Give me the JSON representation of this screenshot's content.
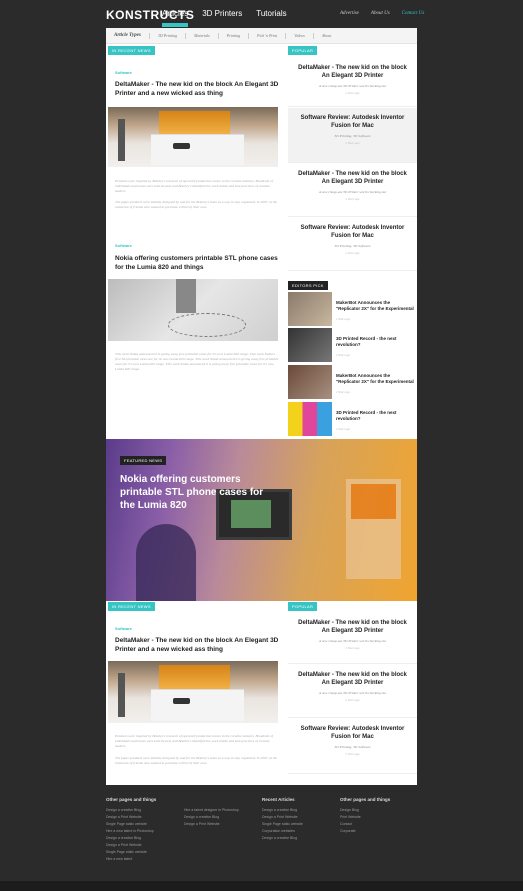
{
  "header": {
    "logo": "KONSTRUCTS",
    "nav": [
      "Articles",
      "3D Printers",
      "Tutorials"
    ],
    "right_nav": [
      "Advertise",
      "About Us",
      "Contact Us"
    ]
  },
  "article_types": {
    "title": "Article Types",
    "items": [
      "3D Printing",
      "Materials",
      "Printing",
      "Pick 'n Print",
      "Videos",
      "About"
    ]
  },
  "section1": {
    "recent_badge": "IN RECENT NEWS",
    "popular_badge": "POPULAR",
    "articles": [
      {
        "category": "Software",
        "title": "DeltaMaker - The new kid on the block An Elegant 3D Printer and a new wicked ass thing",
        "excerpt1": "Products were inspired by Bekeley's research of open/self production routes in the creative industry. Hundreds of individuals and teams were interviewed, and Bekeley's identified the work habits and best practices of creative leaders.",
        "excerpt2": "The paper products were initially designed by and for the Bekeley's team as a way to stay organized. In 2007, at the insistence of friends who wanted to purchase a Pixel of their own."
      },
      {
        "category": "Software",
        "title": "Nokia offering customers printable STL phone cases for the Lumia 820 and things",
        "excerpt1": "This week Nokia announced it is giving away free printable cases for it's new Lumia 820 range. This week Nokia's first 3d-printable cases are for its new Lumia 820 range. This week Nokia announced it is giving away free printable cases for it's new Lumia 820 range. This week Nokia announced it is giving away free printable cases for it's new Lumia 820 range."
      }
    ],
    "popular": [
      {
        "title": "DeltaMaker - The new kid on the block An Elegant 3D Printer",
        "sub": "A new cheap-ass 3D Printer worth checking out",
        "meta": "2 Years ago"
      },
      {
        "title": "Software Review: Autodesk Inventor Fusion for Mac",
        "sub": "3D Printing, 3D Software",
        "meta": "2 Years ago"
      },
      {
        "title": "DeltaMaker - The new kid on the block An Elegant 3D Printer",
        "sub": "A new cheap-ass 3D Printer worth checking out",
        "meta": "2 Years ago"
      },
      {
        "title": "Software Review: Autodesk Inventor Fusion for Mac",
        "sub": "3D Printing, 3D Software",
        "meta": "2 Years ago"
      }
    ],
    "editors_pick_badge": "EDITORS PICK",
    "editors_picks": [
      {
        "title": "MakerBot Announces the \"Replicator 2X\" for the Experimental",
        "meta": "2 Years ago"
      },
      {
        "title": "3D Printed Record - the next revolution?",
        "meta": "2 Years ago"
      },
      {
        "title": "MakerBot Announces the \"Replicator 2X\" for the Experimental",
        "meta": "2 Years ago"
      },
      {
        "title": "3D Printed Record - the next revolution?",
        "meta": "2 Years ago"
      }
    ]
  },
  "featured": {
    "badge": "FEATURED NEWS",
    "title": "Nokia offering customers printable STL phone cases for the Lumia 820"
  },
  "section2": {
    "recent_badge": "IN RECENT NEWS",
    "popular_badge": "POPULAR",
    "article": {
      "category": "Software",
      "title": "DeltaMaker - The new kid on the block An Elegant 3D Printer and a new wicked ass thing",
      "excerpt1": "Products were inspired by Bekeley's research of open/self production routes in the creative industry. Hundreds of individuals and teams were interviewed, and Bekeley's identified the work habits and best practices of creative leaders.",
      "excerpt2": "The paper products were initially designed by and for the Bekeley's team as a way to stay organized. In 2007, at the insistence of friends who wanted to purchase a Pixel of their own."
    },
    "popular": [
      {
        "title": "DeltaMaker - The new kid on the block An Elegant 3D Printer",
        "sub": "A new cheap-ass 3D Printer worth checking out",
        "meta": "2 Years ago"
      },
      {
        "title": "DeltaMaker - The new kid on the block An Elegant 3D Printer",
        "sub": "A new cheap-ass 3D Printer worth checking out",
        "meta": "2 Years ago"
      },
      {
        "title": "Software Review: Autodesk Inventor Fusion for Mac",
        "sub": "3D Printing, 3D Software",
        "meta": "2 Years ago"
      }
    ]
  },
  "footer": {
    "col1": {
      "heading": "Other pages and things",
      "links": [
        "Design a creative Blog",
        "Design a Print Website",
        "Single Page static website",
        "Hire a new talent in Photoshop",
        "Design a creative Blog",
        "Design a Print Website",
        "Single Page static website",
        "Hire a new talent"
      ]
    },
    "col2": {
      "heading": "",
      "links": [
        "Hire a talent designer in Photoshop",
        "Design a creative Blog",
        "Design a Print Website"
      ]
    },
    "col3": {
      "heading": "Recent Articles",
      "links": [
        "Design a creative Blog",
        "Design a Print Website",
        "Single Page static website",
        "Corporation websites",
        "Design a creative Blog"
      ]
    },
    "col4": {
      "heading": "Other pages and things",
      "links": [
        "Design Blog",
        "Print Website",
        "Contact",
        "Corporate"
      ]
    }
  },
  "colors": {
    "accent": "#36c4c4",
    "dark": "#2b2b2b"
  }
}
